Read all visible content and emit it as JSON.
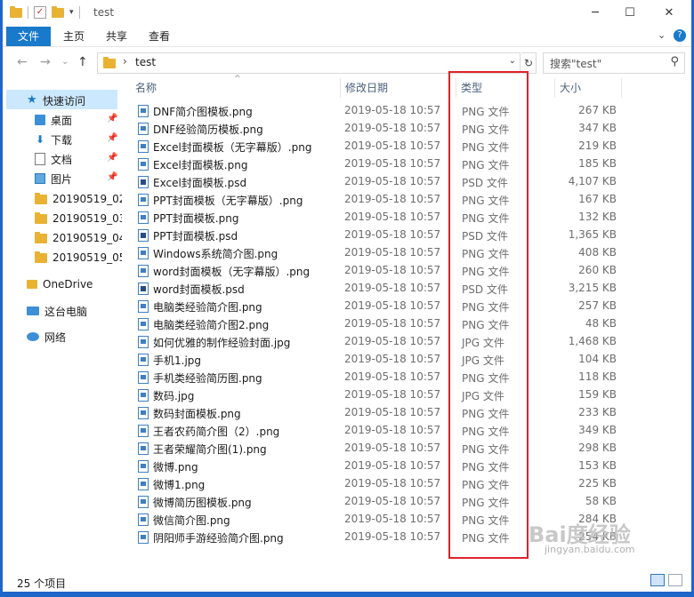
{
  "window": {
    "title": "test"
  },
  "ribbon": {
    "file_tab": "文件",
    "tabs": [
      "主页",
      "共享",
      "查看"
    ]
  },
  "address": {
    "path": "test",
    "search_placeholder": "搜索\"test\""
  },
  "sidebar": {
    "quick_access": "快速访问",
    "pinned": [
      "桌面",
      "下载",
      "文档",
      "图片"
    ],
    "folders": [
      "20190519_02_...",
      "20190519_03_...",
      "20190519_04_...",
      "20190519_05_..."
    ],
    "onedrive": "OneDrive",
    "this_pc": "这台电脑",
    "network": "网络"
  },
  "columns": {
    "name": "名称",
    "date": "修改日期",
    "type": "类型",
    "size": "大小"
  },
  "files": [
    {
      "name": "DNF简介图模板.png",
      "date": "2019-05-18 10:57",
      "type": "PNG 文件",
      "size": "267 KB"
    },
    {
      "name": "DNF经验简历模板.png",
      "date": "2019-05-18 10:57",
      "type": "PNG 文件",
      "size": "347 KB"
    },
    {
      "name": "Excel封面模板（无字幕版）.png",
      "date": "2019-05-18 10:57",
      "type": "PNG 文件",
      "size": "219 KB"
    },
    {
      "name": "Excel封面模板.png",
      "date": "2019-05-18 10:57",
      "type": "PNG 文件",
      "size": "185 KB"
    },
    {
      "name": "Excel封面模板.psd",
      "date": "2019-05-18 10:57",
      "type": "PSD 文件",
      "size": "4,107 KB"
    },
    {
      "name": "PPT封面模板（无字幕版）.png",
      "date": "2019-05-18 10:57",
      "type": "PNG 文件",
      "size": "167 KB"
    },
    {
      "name": "PPT封面模板.png",
      "date": "2019-05-18 10:57",
      "type": "PNG 文件",
      "size": "132 KB"
    },
    {
      "name": "PPT封面模板.psd",
      "date": "2019-05-18 10:57",
      "type": "PSD 文件",
      "size": "1,365 KB"
    },
    {
      "name": "Windows系统简介图.png",
      "date": "2019-05-18 10:57",
      "type": "PNG 文件",
      "size": "408 KB"
    },
    {
      "name": "word封面模板（无字幕版）.png",
      "date": "2019-05-18 10:57",
      "type": "PNG 文件",
      "size": "260 KB"
    },
    {
      "name": "word封面模板.psd",
      "date": "2019-05-18 10:57",
      "type": "PSD 文件",
      "size": "3,215 KB"
    },
    {
      "name": "电脑类经验简介图.png",
      "date": "2019-05-18 10:57",
      "type": "PNG 文件",
      "size": "257 KB"
    },
    {
      "name": "电脑类经验简介图2.png",
      "date": "2019-05-18 10:57",
      "type": "PNG 文件",
      "size": "48 KB"
    },
    {
      "name": "如何优雅的制作经验封面.jpg",
      "date": "2019-05-18 10:57",
      "type": "JPG 文件",
      "size": "1,468 KB"
    },
    {
      "name": "手机1.jpg",
      "date": "2019-05-18 10:57",
      "type": "JPG 文件",
      "size": "104 KB"
    },
    {
      "name": "手机类经验简历图.png",
      "date": "2019-05-18 10:57",
      "type": "PNG 文件",
      "size": "118 KB"
    },
    {
      "name": "数码.jpg",
      "date": "2019-05-18 10:57",
      "type": "JPG 文件",
      "size": "159 KB"
    },
    {
      "name": "数码封面模板.png",
      "date": "2019-05-18 10:57",
      "type": "PNG 文件",
      "size": "233 KB"
    },
    {
      "name": "王者农药简介图（2）.png",
      "date": "2019-05-18 10:57",
      "type": "PNG 文件",
      "size": "349 KB"
    },
    {
      "name": "王者荣耀简介图(1).png",
      "date": "2019-05-18 10:57",
      "type": "PNG 文件",
      "size": "298 KB"
    },
    {
      "name": "微博.png",
      "date": "2019-05-18 10:57",
      "type": "PNG 文件",
      "size": "153 KB"
    },
    {
      "name": "微博1.png",
      "date": "2019-05-18 10:57",
      "type": "PNG 文件",
      "size": "225 KB"
    },
    {
      "name": "微博简历图模板.png",
      "date": "2019-05-18 10:57",
      "type": "PNG 文件",
      "size": "58 KB"
    },
    {
      "name": "微信简介图.png",
      "date": "2019-05-18 10:57",
      "type": "PNG 文件",
      "size": "284 KB"
    },
    {
      "name": "阴阳师手游经验简介图.png",
      "date": "2019-05-18 10:57",
      "type": "PNG 文件",
      "size": "254 KB"
    }
  ],
  "status": {
    "item_count": "25 个项目"
  },
  "watermark": {
    "main": "Bai度经验",
    "sub": "jingyan.baidu.com"
  },
  "colors": {
    "accent": "#1979ca",
    "selection": "#cce8ff",
    "highlight_box": "#e0232a",
    "folder": "#e9b233"
  }
}
